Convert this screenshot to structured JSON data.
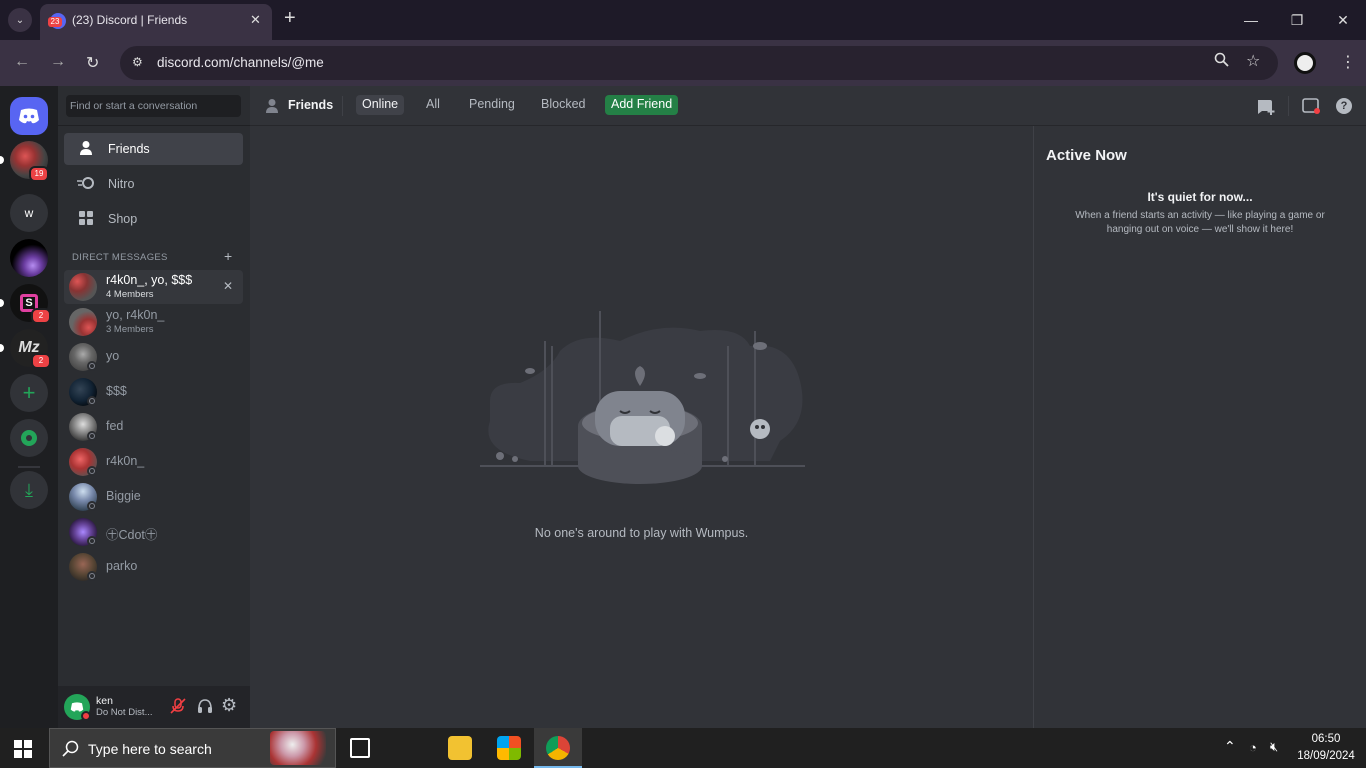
{
  "browser": {
    "tab_title": "(23) Discord | Friends",
    "tab_badge": "23",
    "url": "discord.com/channels/@me",
    "new_tab": "+",
    "minimize": "—",
    "restore": "❐",
    "close": "✕"
  },
  "guilds": {
    "items": [
      {
        "name": "home",
        "badge": ""
      },
      {
        "name": "dm-avatar",
        "badge": "19"
      },
      {
        "name": "w",
        "label": "w",
        "badge": ""
      },
      {
        "name": "purple",
        "badge": ""
      },
      {
        "name": "s",
        "badge": "2"
      },
      {
        "name": "mz",
        "badge": "2"
      }
    ],
    "add": "+",
    "explore": "◉",
    "download": "⤓"
  },
  "sidebar": {
    "search_placeholder": "Find or start a conversation",
    "nav": [
      {
        "label": "Friends",
        "icon": "person-wave-icon"
      },
      {
        "label": "Nitro",
        "icon": "nitro-icon"
      },
      {
        "label": "Shop",
        "icon": "shop-icon"
      }
    ],
    "dm_header": "DIRECT MESSAGES",
    "dm_add": "+",
    "dms": [
      {
        "name": "r4k0n_, yo, $$$",
        "sub": "4 Members"
      },
      {
        "name": "yo, r4k0n_",
        "sub": "3 Members"
      },
      {
        "name": "yo",
        "sub": ""
      },
      {
        "name": "$$$",
        "sub": ""
      },
      {
        "name": "fed",
        "sub": ""
      },
      {
        "name": "r4k0n_",
        "sub": ""
      },
      {
        "name": "Biggie",
        "sub": ""
      },
      {
        "name": "㊉Cdot㊉",
        "sub": ""
      },
      {
        "name": "parko",
        "sub": ""
      }
    ],
    "user": {
      "name": "ken",
      "status": "Do Not Dist..."
    }
  },
  "topbar": {
    "title": "Friends",
    "tabs": [
      "Online",
      "All",
      "Pending",
      "Blocked"
    ],
    "add_friend": "Add Friend"
  },
  "main": {
    "empty_text": "No one's around to play with Wumpus."
  },
  "active_now": {
    "title": "Active Now",
    "quiet_title": "It's quiet for now...",
    "quiet_desc": "When a friend starts an activity — like playing a game or hanging out on voice — we'll show it here!"
  },
  "taskbar": {
    "search_placeholder": "Type here to search",
    "time": "06:50",
    "date": "18/09/2024"
  }
}
